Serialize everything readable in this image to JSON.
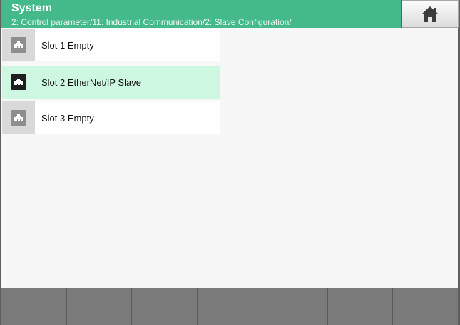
{
  "header": {
    "title": "System",
    "breadcrumb": "2: Control parameter/11: Industrial Communication/2: Slave Configuration/"
  },
  "home_button": {
    "icon": "home-icon"
  },
  "slots": [
    {
      "label": "Slot 1 Empty",
      "icon": "ethernet-port-icon",
      "selected": false
    },
    {
      "label": "Slot 2 EtherNet/IP Slave",
      "icon": "ethernet-port-icon",
      "selected": true
    },
    {
      "label": "Slot 3 Empty",
      "icon": "ethernet-port-icon",
      "selected": false
    }
  ],
  "footer": {
    "button_count": 7
  },
  "colors": {
    "header": "#44b98a",
    "selected_row": "#cef7e2",
    "footer_button": "#7a7a7a"
  }
}
